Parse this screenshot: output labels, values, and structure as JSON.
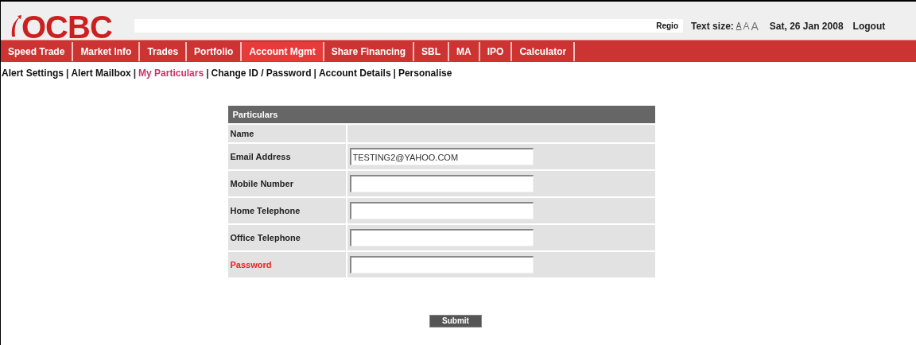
{
  "header": {
    "logo": "OCBC",
    "search_fragment": "Regio",
    "text_size_label": "Text size:",
    "text_sizes": [
      {
        "label": "A",
        "selected": true
      },
      {
        "label": "A",
        "selected": false
      },
      {
        "label": "A",
        "selected": false
      }
    ],
    "date": "Sat, 26 Jan 2008",
    "logout": "Logout"
  },
  "tabs": [
    {
      "label": "Speed Trade",
      "selected": false
    },
    {
      "label": "Market Info",
      "selected": false
    },
    {
      "label": "Trades",
      "selected": false
    },
    {
      "label": "Portfolio",
      "selected": false
    },
    {
      "label": "Account Mgmt",
      "selected": true
    },
    {
      "label": "Share Financing",
      "selected": false
    },
    {
      "label": "SBL",
      "selected": false
    },
    {
      "label": "MA",
      "selected": false
    },
    {
      "label": "IPO",
      "selected": false
    },
    {
      "label": "Calculator",
      "selected": false
    }
  ],
  "subnav": [
    {
      "label": "Alert Settings",
      "selected": false
    },
    {
      "separator": "|",
      "label": "Alert Mailbox",
      "selected": false
    },
    {
      "separator": "|",
      "label": "My Particulars",
      "selected": true
    },
    {
      "separator": "|",
      "label": "Change ID / Password",
      "selected": false
    },
    {
      "separator": "|",
      "label": "Account Details",
      "selected": false
    },
    {
      "separator": "|",
      "label": "Personalise",
      "selected": false
    }
  ],
  "form": {
    "title": "Particulars",
    "rows": [
      {
        "label": "Name",
        "kind": "text",
        "emphasized": false
      },
      {
        "label": "Email Address",
        "kind": "input",
        "emphasized": false,
        "value": "TESTING2@YAHOO.COM"
      },
      {
        "label": "Mobile Number",
        "kind": "input",
        "emphasized": false
      },
      {
        "label": "Home Telephone",
        "kind": "input",
        "emphasized": false
      },
      {
        "label": "Office Telephone",
        "kind": "input",
        "emphasized": false
      },
      {
        "label": "Password",
        "kind": "input",
        "emphasized": true
      }
    ],
    "submit": "Submit"
  }
}
